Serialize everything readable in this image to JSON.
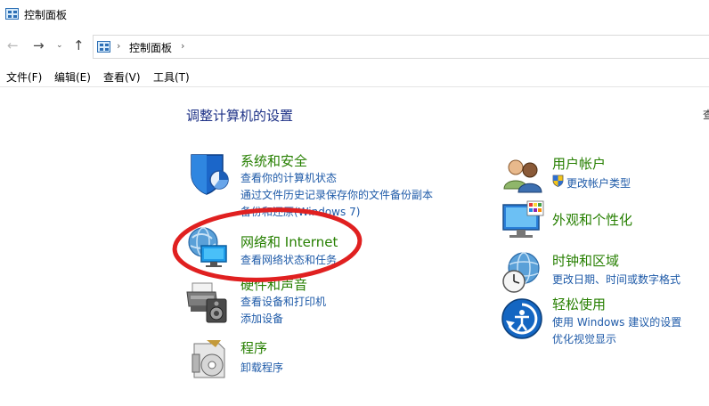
{
  "window": {
    "title": "控制面板"
  },
  "address_bar": {
    "crumbs": [
      "控制面板"
    ]
  },
  "menu": [
    "文件(F)",
    "编辑(E)",
    "查看(V)",
    "工具(T)"
  ],
  "heading": "调整计算机的设置",
  "view_by_cut": "查",
  "categories_left": [
    {
      "title": "系统和安全",
      "icon": "shield-icon",
      "links": [
        "查看你的计算机状态",
        "通过文件历史记录保存你的文件备份副本",
        "备份和还原(Windows 7)"
      ]
    },
    {
      "title": "网络和 Internet",
      "icon": "network-globe-icon",
      "links": [
        "查看网络状态和任务"
      ]
    },
    {
      "title": "硬件和声音",
      "icon": "printer-speaker-icon",
      "links": [
        "查看设备和打印机",
        "添加设备"
      ]
    },
    {
      "title": "程序",
      "icon": "programs-disc-icon",
      "links": [
        "卸载程序"
      ]
    }
  ],
  "categories_right": [
    {
      "title": "用户帐户",
      "icon": "users-icon",
      "links": [
        "更改帐户类型"
      ],
      "link_icon": "uac-shield-icon"
    },
    {
      "title": "外观和个性化",
      "icon": "monitor-palette-icon",
      "links": []
    },
    {
      "title": "时钟和区域",
      "icon": "clock-globe-icon",
      "links": [
        "更改日期、时间或数字格式"
      ]
    },
    {
      "title": "轻松使用",
      "icon": "ease-of-access-icon",
      "links": [
        "使用 Windows 建议的设置",
        "优化视觉显示"
      ]
    }
  ],
  "annotation": {
    "color": "#e02020"
  }
}
